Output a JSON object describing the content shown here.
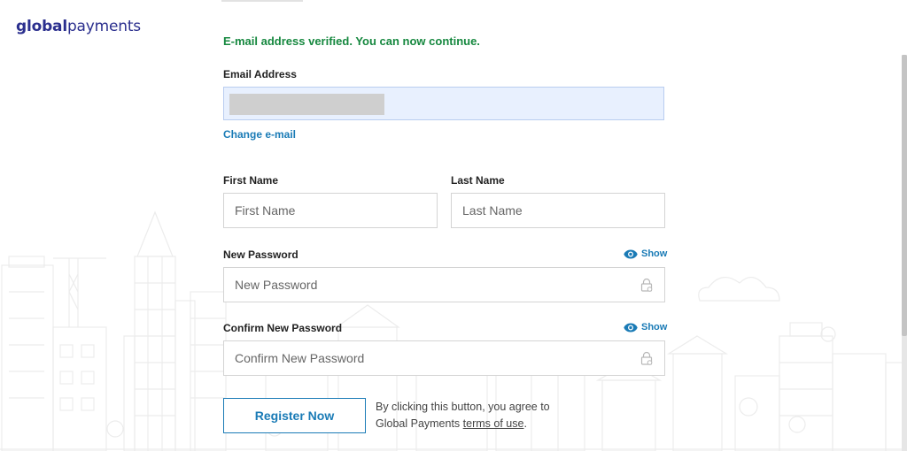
{
  "brand": {
    "logo_bold": "global",
    "logo_light": "payments"
  },
  "form": {
    "verified_message": "E-mail address verified. You can now continue.",
    "email": {
      "label": "Email Address",
      "value": ""
    },
    "change_email_link": "Change e-mail",
    "first_name": {
      "label": "First Name",
      "placeholder": "First Name"
    },
    "last_name": {
      "label": "Last Name",
      "placeholder": "Last Name"
    },
    "new_password": {
      "label": "New Password",
      "placeholder": "New Password",
      "show_label": "Show"
    },
    "confirm_password": {
      "label": "Confirm New Password",
      "placeholder": "Confirm New Password",
      "show_label": "Show"
    },
    "register_button": "Register Now",
    "agreement_prefix": "By clicking this button, you agree to Global Payments",
    "terms_link": "terms of use",
    "agreement_suffix": "."
  },
  "colors": {
    "success": "#16883f",
    "link": "#1a7bb6",
    "brand": "#2b2f8e",
    "brand_accent": "#1fa3df",
    "autofill_bg": "#e8f0fe"
  },
  "icons": {
    "show_password": "eye-icon",
    "password_field": "lock-icon"
  }
}
